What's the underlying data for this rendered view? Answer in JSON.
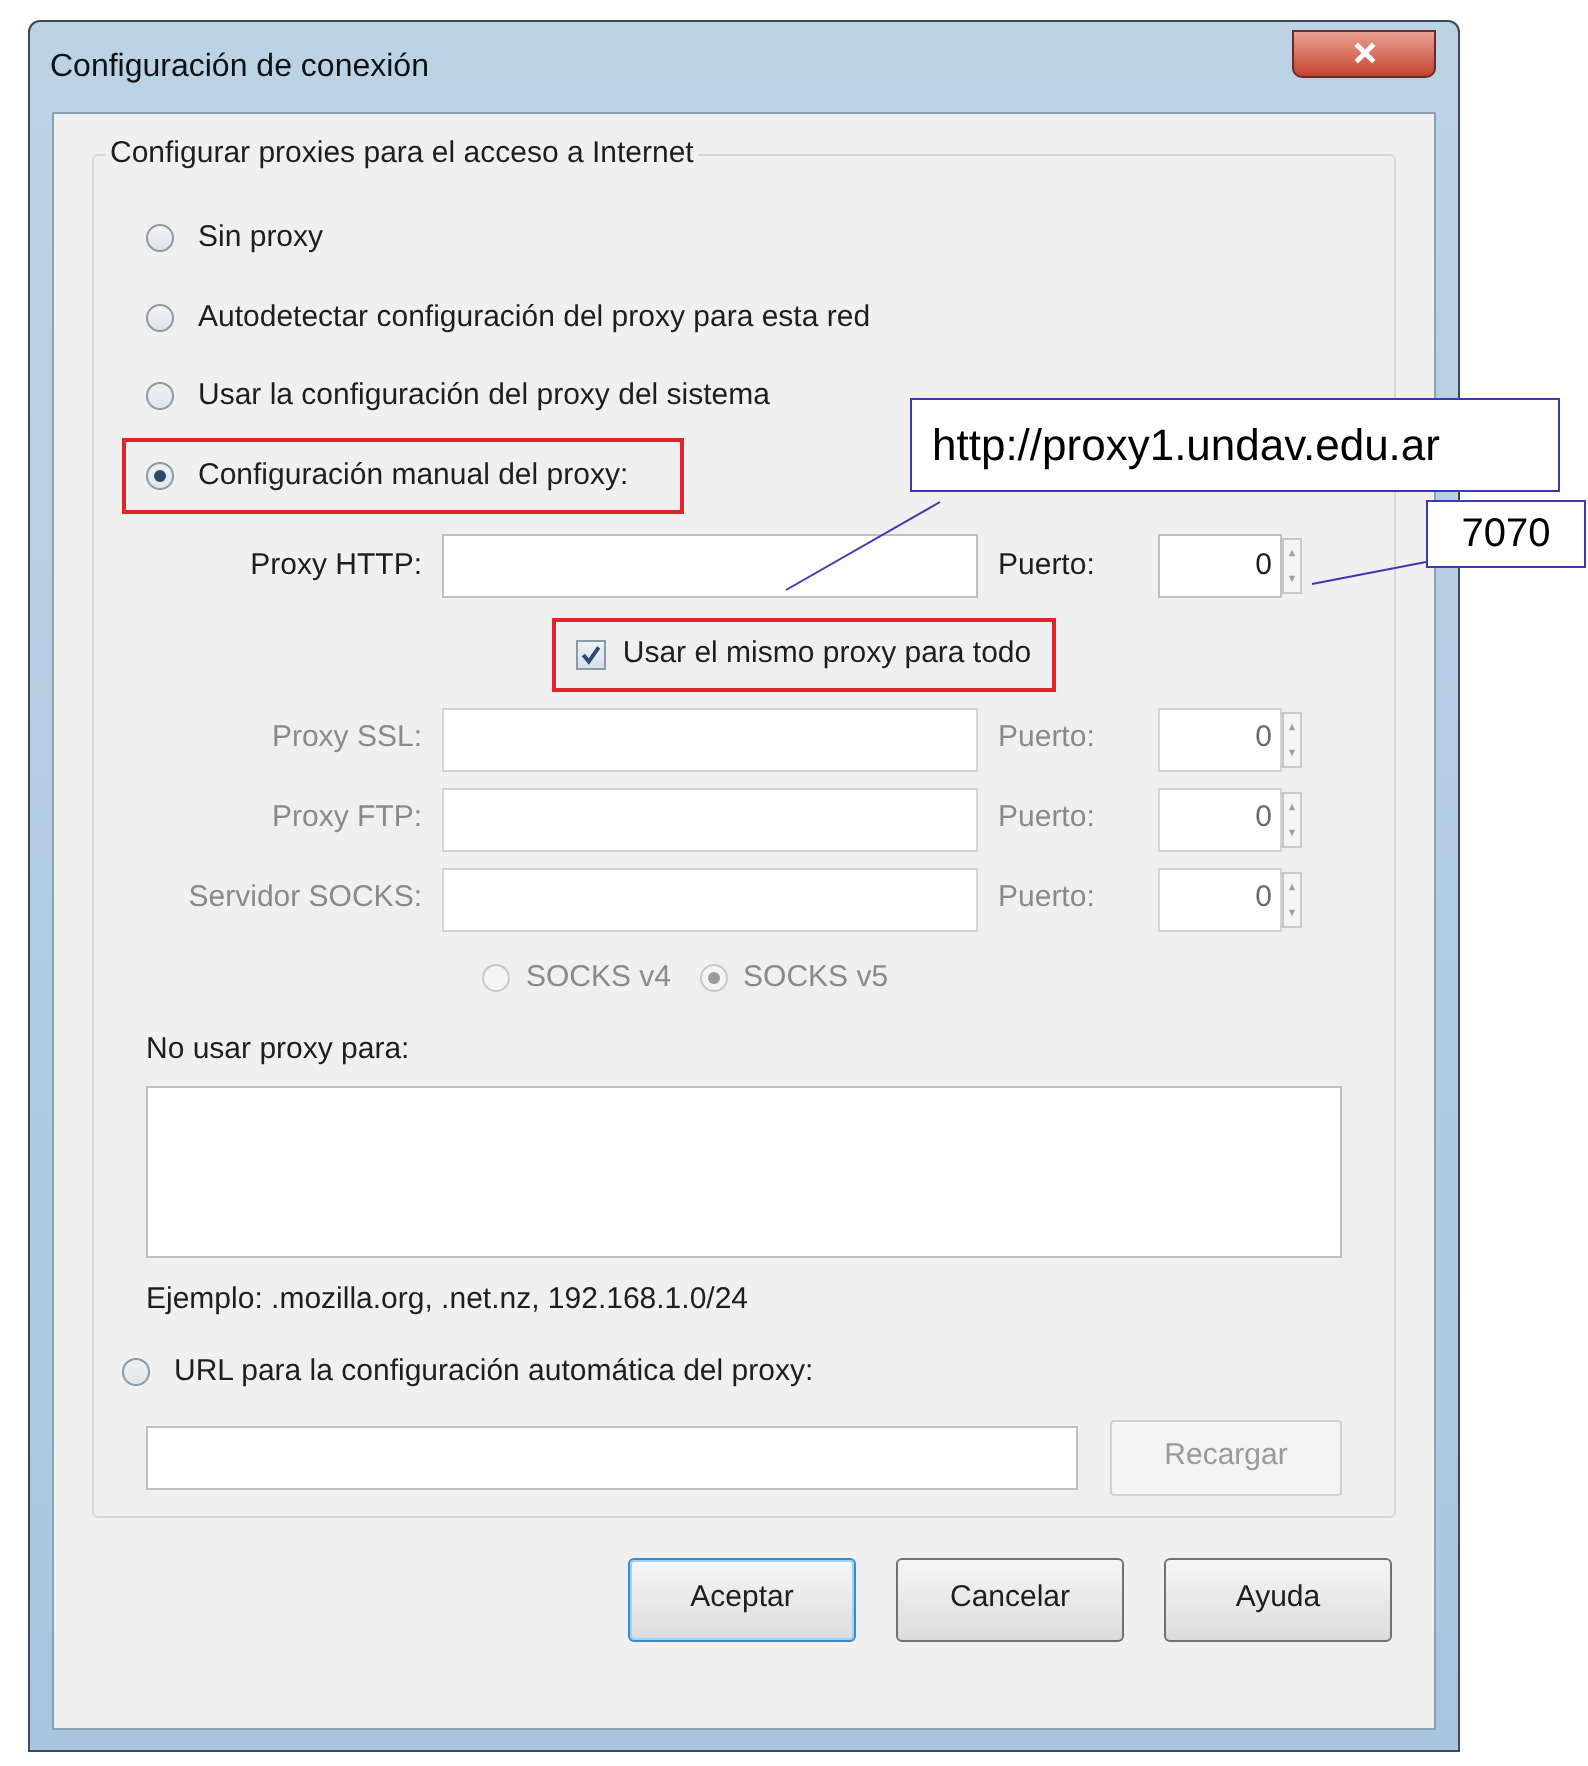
{
  "window": {
    "title": "Configuración de conexión"
  },
  "group_title": "Configurar proxies para el acceso a Internet",
  "proxy_modes": [
    {
      "label": "Sin proxy",
      "selected": false,
      "highlighted": false
    },
    {
      "label": "Autodetectar configuración del proxy para esta red",
      "selected": false,
      "highlighted": false
    },
    {
      "label": "Usar la configuración del proxy del sistema",
      "selected": false,
      "highlighted": false
    },
    {
      "label": "Configuración manual del proxy:",
      "selected": true,
      "highlighted": true
    }
  ],
  "proxies": [
    {
      "label": "Proxy HTTP:",
      "port_label": "Puerto:",
      "port": "0",
      "disabled": false
    },
    {
      "label": "Proxy SSL:",
      "port_label": "Puerto:",
      "port": "0",
      "disabled": true
    },
    {
      "label": "Proxy FTP:",
      "port_label": "Puerto:",
      "port": "0",
      "disabled": true
    },
    {
      "label": "Servidor SOCKS:",
      "port_label": "Puerto:",
      "port": "0",
      "disabled": true
    }
  ],
  "same_proxy": {
    "label": "Usar el mismo proxy para todo",
    "checked": true,
    "highlighted": true
  },
  "socks_versions": [
    {
      "label": "SOCKS v4",
      "selected": false,
      "disabled": true
    },
    {
      "label": "SOCKS v5",
      "selected": true,
      "disabled": true
    }
  ],
  "no_proxy": {
    "label": "No usar proxy para:",
    "example": "Ejemplo: .mozilla.org, .net.nz, 192.168.1.0/24"
  },
  "auto_url": {
    "label": "URL para la configuración automática del proxy:",
    "selected": false,
    "reload": "Recargar",
    "reload_disabled": true
  },
  "buttons": [
    {
      "label": "Aceptar",
      "default": true
    },
    {
      "label": "Cancelar",
      "default": false
    },
    {
      "label": "Ayuda",
      "default": false
    }
  ],
  "callouts": [
    {
      "text": "http://proxy1.undav.edu.ar"
    },
    {
      "text": "7070"
    }
  ]
}
